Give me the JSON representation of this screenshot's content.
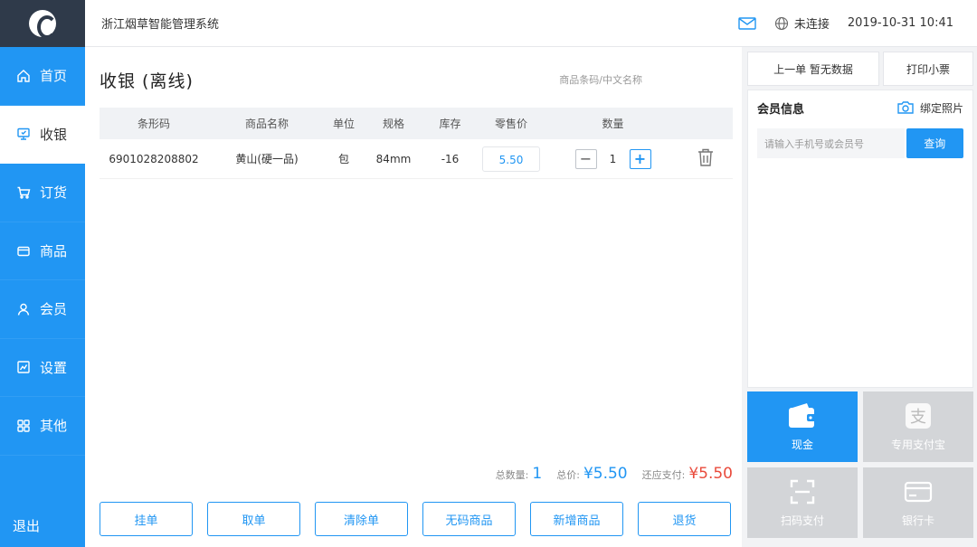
{
  "app": {
    "title": "浙江烟草智能管理系统"
  },
  "topbar": {
    "connection_status": "未连接",
    "datetime": "2019-10-31 10:41",
    "icons": [
      "mail-icon",
      "globe-icon"
    ]
  },
  "sidebar": {
    "items": [
      {
        "label": "首页",
        "icon": "home-icon"
      },
      {
        "label": "收银",
        "icon": "cashier-icon",
        "active": true
      },
      {
        "label": "订货",
        "icon": "cart-icon"
      },
      {
        "label": "商品",
        "icon": "product-icon"
      },
      {
        "label": "会员",
        "icon": "member-icon"
      },
      {
        "label": "设置",
        "icon": "settings-icon"
      },
      {
        "label": "其他",
        "icon": "grid-icon"
      }
    ],
    "bottom_label": "退出"
  },
  "main": {
    "title": "收银  (离线)",
    "search_placeholder": "商品条码/中文名称",
    "columns": [
      "条形码",
      "商品名称",
      "单位",
      "规格",
      "库存",
      "零售价",
      "数量"
    ],
    "rows": [
      {
        "barcode": "6901028208802",
        "name": "黄山(硬一品)",
        "unit": "包",
        "spec": "84mm",
        "stock": "-16",
        "price": "5.50",
        "qty": "1"
      }
    ],
    "totals": {
      "count_label": "总数量:",
      "count": "1",
      "price_label": "总价:",
      "price": "¥5.50",
      "due_label": "还应支付:",
      "due": "¥5.50"
    },
    "actions": [
      "挂单",
      "取单",
      "清除单",
      "无码商品",
      "新增商品",
      "退货"
    ]
  },
  "right": {
    "prev_order": "上一单 暂无数据",
    "print": "打印小票",
    "member_title": "会员信息",
    "bind_photo": "绑定照片",
    "member_placeholder": "请输入手机号或会员号",
    "query": "查询",
    "payments": [
      {
        "label": "现金",
        "icon": "wallet-icon"
      },
      {
        "label": "专用支付宝",
        "icon": "alipay-icon"
      },
      {
        "label": "扫码支付",
        "icon": "scan-icon"
      },
      {
        "label": "银行卡",
        "icon": "bank-card-icon"
      }
    ]
  },
  "colors": {
    "primary": "#2196f3",
    "danger": "#e94b3c",
    "logo_bg": "#2f3a4a"
  }
}
